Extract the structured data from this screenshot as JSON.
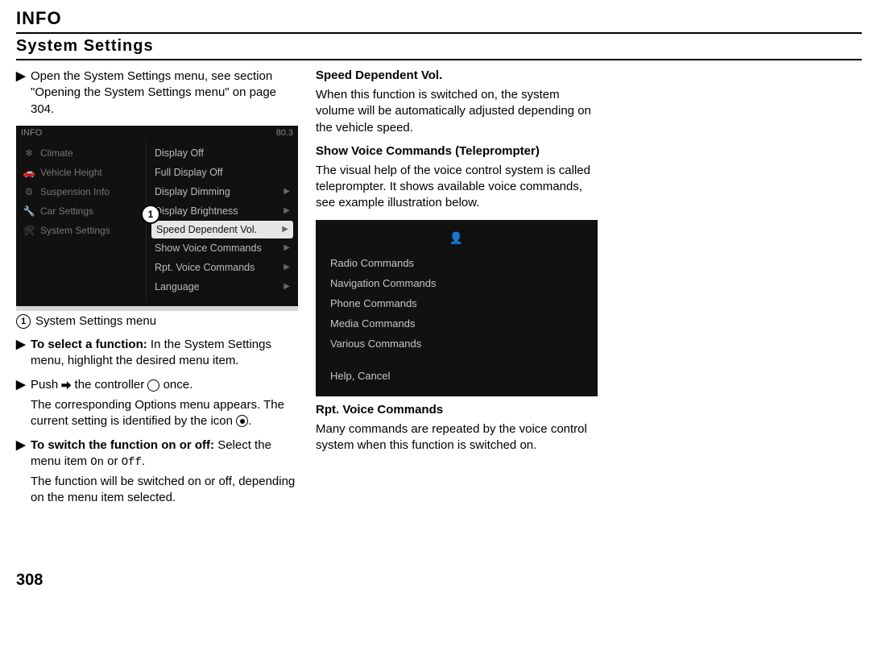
{
  "header": {
    "title": "INFO"
  },
  "subheader": {
    "title": "System Settings"
  },
  "left": {
    "step1": "Open the System Settings menu, see section \"Opening the System Settings menu\" on page 304.",
    "fig1": {
      "topLeft": "INFO",
      "topRight": "80.3",
      "leftItems": [
        {
          "icon": "❄",
          "label": "Climate"
        },
        {
          "icon": "🚗",
          "label": "Vehicle Height"
        },
        {
          "icon": "⚙",
          "label": "Suspension Info"
        },
        {
          "icon": "🔧",
          "label": "Car Settings"
        },
        {
          "icon": "🛠",
          "label": "System Settings"
        }
      ],
      "rightItems": [
        {
          "label": "Display Off",
          "arrow": false,
          "sel": false
        },
        {
          "label": "Full Display Off",
          "arrow": false,
          "sel": false
        },
        {
          "label": "Display Dimming",
          "arrow": true,
          "sel": false
        },
        {
          "label": "Display Brightness",
          "arrow": true,
          "sel": false
        },
        {
          "label": "Speed Dependent Vol.",
          "arrow": true,
          "sel": true
        },
        {
          "label": "Show Voice Commands",
          "arrow": true,
          "sel": false
        },
        {
          "label": "Rpt. Voice Commands",
          "arrow": true,
          "sel": false
        },
        {
          "label": "Language",
          "arrow": true,
          "sel": false
        }
      ],
      "footerLeft": "",
      "footerRight": "",
      "badge": "1"
    },
    "legend": {
      "num": "1",
      "text": "System Settings menu"
    },
    "step2_lead": "To select a function:",
    "step2_rest": " In the System Settings menu, highlight the desired menu item.",
    "step3_a": "Push ",
    "step3_b": " the controller ",
    "step3_c": " once.",
    "step3_p1a": "The corresponding Options menu appears. The current setting is identified by the icon ",
    "step3_p1b": ".",
    "step4_lead": "To switch the function on or off:",
    "step4_a": " Select the menu item ",
    "step4_on": "On",
    "step4_or": " or ",
    "step4_off": "Off",
    "step4_end": ".",
    "step4_p": "The function will be switched on or off, depending on the menu item selected."
  },
  "right": {
    "h1": "Speed Dependent Vol.",
    "p1": "When this function is switched on, the system volume will be automatically adjusted depending on the vehicle speed.",
    "h2": "Show Voice Commands (Teleprompter)",
    "p2": "The visual help of the voice control system is called teleprompter. It shows available voice commands, see example illustration below.",
    "fig2": {
      "headIcon": "👤",
      "items": [
        "Radio Commands",
        "Navigation Commands",
        "Phone Commands",
        "Media Commands",
        "Various Commands"
      ],
      "footer": "Help, Cancel"
    },
    "h3": "Rpt. Voice Commands",
    "p3": "Many commands are repeated by the voice control system when this function is switched on."
  },
  "pageNumber": "308"
}
